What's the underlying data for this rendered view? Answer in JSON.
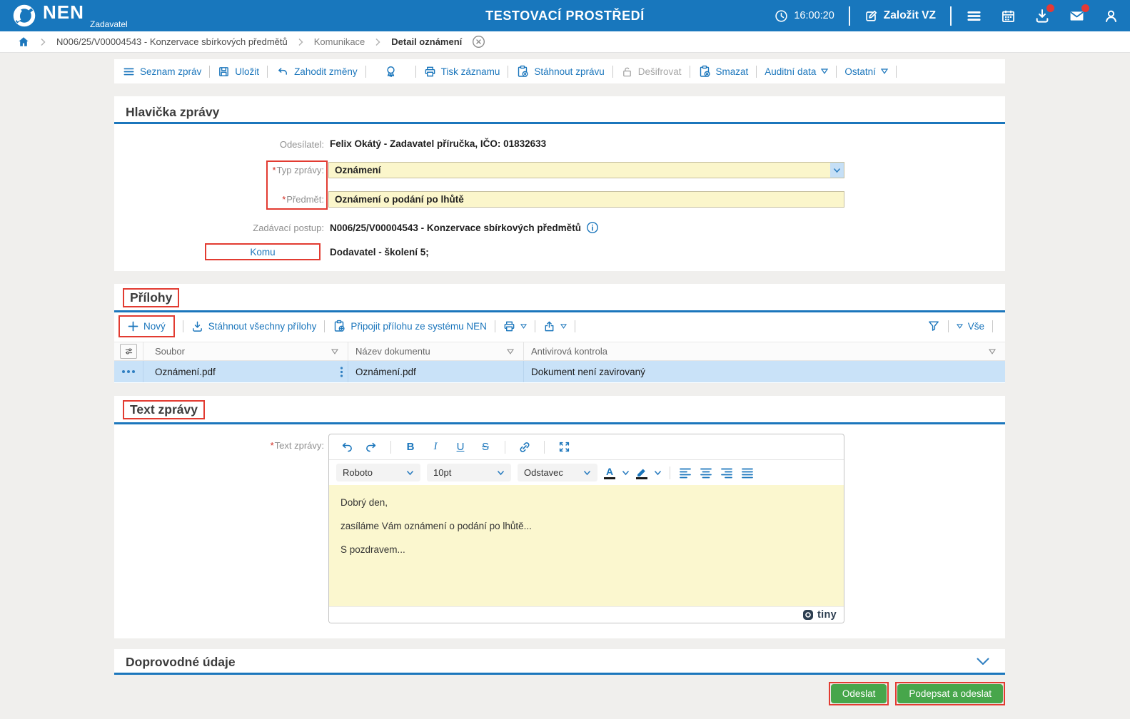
{
  "header": {
    "logo": "NEN",
    "logo_sub": "Zadavatel",
    "env_title": "TESTOVACÍ PROSTŘEDÍ",
    "time": "16:00:20",
    "create_vz_label": "Založit VZ"
  },
  "breadcrumb": {
    "procedure": "N006/25/V00004543 - Konzervace sbírkových předmětů",
    "section": "Komunikace",
    "current": "Detail oznámení"
  },
  "toolbar": {
    "seznam_zprav": "Seznam zpráv",
    "ulozit": "Uložit",
    "zahodit_zmeny": "Zahodit změny",
    "tisk_zaznamu": "Tisk záznamu",
    "stahnout_zpravu": "Stáhnout zprávu",
    "desifrovat": "Dešifrovat",
    "smazat": "Smazat",
    "auditni_data": "Auditní data",
    "ostatni": "Ostatní"
  },
  "misc": {
    "required_marker": "*"
  },
  "message_header": {
    "title": "Hlavička zprávy",
    "odesilatel_label": "Odesílatel:",
    "odesilatel_value": "Felix Okátý - Zadavatel příručka, IČO: 01832633",
    "typ_zpravy_label": "Typ zprávy:",
    "typ_zpravy_value": "Oznámení",
    "predmet_label": "Předmět:",
    "predmet_value": "Oznámení o podání po lhůtě",
    "zadavaci_postup_label": "Zadávací postup:",
    "zadavaci_postup_value": "N006/25/V00004543 - Konzervace sbírkových předmětů",
    "komu_label": "Komu",
    "komu_value": "Dodavatel - školení 5;"
  },
  "attachments": {
    "title": "Přílohy",
    "novy": "Nový",
    "stahnout_vsechny": "Stáhnout všechny přílohy",
    "pripojit": "Připojit přílohu ze systému NEN",
    "vse_filter": "Vše",
    "columns": {
      "soubor": "Soubor",
      "nazev": "Název dokumentu",
      "antivir": "Antivirová kontrola"
    },
    "rows": [
      {
        "soubor": "Oznámení.pdf",
        "nazev": "Oznámení.pdf",
        "antivir": "Dokument není zavirovaný"
      }
    ]
  },
  "message_text": {
    "title": "Text zprávy",
    "label": "Text zprávy:",
    "editor": {
      "glyphs": {
        "bold": "B",
        "italic": "I",
        "underline": "U",
        "strike": "S"
      },
      "font_family": "Roboto",
      "font_size": "10pt",
      "block_format": "Odstavec",
      "color_letter": "A",
      "paragraphs": [
        "Dobrý den,",
        "zasíláme Vám oznámení o podání po lhůtě...",
        "S pozdravem..."
      ],
      "brand": "tiny"
    }
  },
  "additional_section": {
    "title": "Doprovodné údaje"
  },
  "footer": {
    "odeslat": "Odeslat",
    "podepsat_a_odeslat": "Podepsat a odeslat"
  },
  "colors": {
    "header_blue": "#1877bd",
    "link_blue": "#1b76bc",
    "field_yellow": "#fbf6cb",
    "selected_row": "#c9e2f8",
    "button_green": "#47a64b",
    "annotation_red": "#e23b31",
    "badge_red": "#e53935"
  }
}
